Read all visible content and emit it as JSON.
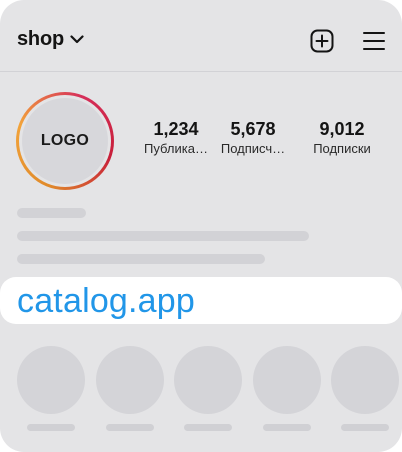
{
  "header": {
    "username": "shop",
    "icons": {
      "dropdown": "chevron-down-icon",
      "create": "plus-square-icon",
      "menu": "hamburger-menu-icon"
    }
  },
  "profile": {
    "avatar_text": "LOGO",
    "stats": [
      {
        "value": "1,234",
        "label": "Публика…"
      },
      {
        "value": "5,678",
        "label": "Подписч…"
      },
      {
        "value": "9,012",
        "label": "Подписки"
      }
    ]
  },
  "bio": {
    "link": "catalog.app"
  },
  "colors": {
    "background": "#e4e4e6",
    "link": "#2196e8",
    "ring_start": "#f2a33a",
    "ring_end": "#c81f3a",
    "placeholder": "#d2d2d6"
  }
}
